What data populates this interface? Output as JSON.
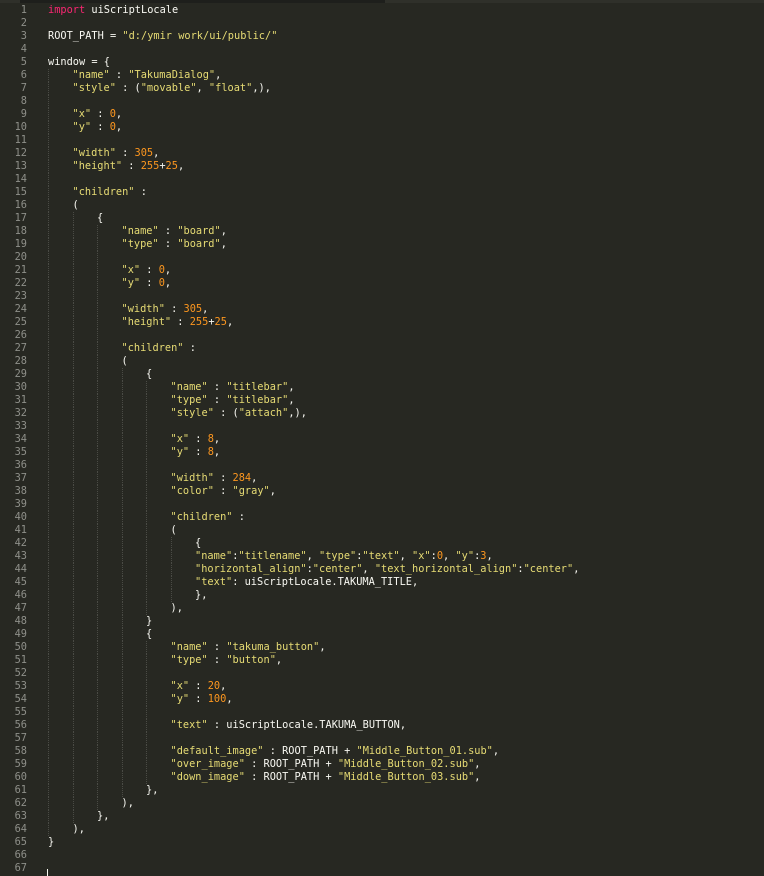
{
  "editor": {
    "language": "python",
    "theme_colors": {
      "background": "#272822",
      "keyword": "#f92672",
      "string": "#e6db74",
      "number": "#fd971f",
      "text": "#f8f8f2",
      "gutter": "#8f908a"
    },
    "lines": [
      {
        "n": "1",
        "indent": 0,
        "tokens": [
          [
            "imp",
            "import"
          ],
          [
            "txt",
            " uiScriptLocale"
          ]
        ]
      },
      {
        "n": "2",
        "indent": 0,
        "tokens": []
      },
      {
        "n": "3",
        "indent": 0,
        "tokens": [
          [
            "txt",
            "ROOT_PATH = "
          ],
          [
            "str",
            "\"d:/ymir work/ui/public/\""
          ]
        ]
      },
      {
        "n": "4",
        "indent": 0,
        "tokens": []
      },
      {
        "n": "5",
        "indent": 0,
        "tokens": [
          [
            "txt",
            "window = {"
          ]
        ]
      },
      {
        "n": "6",
        "indent": 1,
        "tokens": [
          [
            "str",
            "\"name\""
          ],
          [
            "txt",
            " : "
          ],
          [
            "str",
            "\"TakumaDialog\""
          ],
          [
            "txt",
            ","
          ]
        ]
      },
      {
        "n": "7",
        "indent": 1,
        "tokens": [
          [
            "str",
            "\"style\""
          ],
          [
            "txt",
            " : ("
          ],
          [
            "str",
            "\"movable\""
          ],
          [
            "txt",
            ", "
          ],
          [
            "str",
            "\"float\""
          ],
          [
            "txt",
            ",),"
          ]
        ]
      },
      {
        "n": "8",
        "indent": 1,
        "tokens": []
      },
      {
        "n": "9",
        "indent": 1,
        "tokens": [
          [
            "str",
            "\"x\""
          ],
          [
            "txt",
            " : "
          ],
          [
            "num",
            "0"
          ],
          [
            "txt",
            ","
          ]
        ]
      },
      {
        "n": "10",
        "indent": 1,
        "tokens": [
          [
            "str",
            "\"y\""
          ],
          [
            "txt",
            " : "
          ],
          [
            "num",
            "0"
          ],
          [
            "txt",
            ","
          ]
        ]
      },
      {
        "n": "11",
        "indent": 1,
        "tokens": []
      },
      {
        "n": "12",
        "indent": 1,
        "tokens": [
          [
            "str",
            "\"width\""
          ],
          [
            "txt",
            " : "
          ],
          [
            "num",
            "305"
          ],
          [
            "txt",
            ","
          ]
        ]
      },
      {
        "n": "13",
        "indent": 1,
        "tokens": [
          [
            "str",
            "\"height\""
          ],
          [
            "txt",
            " : "
          ],
          [
            "num",
            "255"
          ],
          [
            "txt",
            "+"
          ],
          [
            "num",
            "25"
          ],
          [
            "txt",
            ","
          ]
        ]
      },
      {
        "n": "14",
        "indent": 1,
        "tokens": []
      },
      {
        "n": "15",
        "indent": 1,
        "tokens": [
          [
            "str",
            "\"children\""
          ],
          [
            "txt",
            " :"
          ]
        ]
      },
      {
        "n": "16",
        "indent": 1,
        "tokens": [
          [
            "txt",
            "("
          ]
        ]
      },
      {
        "n": "17",
        "indent": 2,
        "tokens": [
          [
            "txt",
            "{"
          ]
        ]
      },
      {
        "n": "18",
        "indent": 3,
        "tokens": [
          [
            "str",
            "\"name\""
          ],
          [
            "txt",
            " : "
          ],
          [
            "str",
            "\"board\""
          ],
          [
            "txt",
            ","
          ]
        ]
      },
      {
        "n": "19",
        "indent": 3,
        "tokens": [
          [
            "str",
            "\"type\""
          ],
          [
            "txt",
            " : "
          ],
          [
            "str",
            "\"board\""
          ],
          [
            "txt",
            ","
          ]
        ]
      },
      {
        "n": "20",
        "indent": 3,
        "tokens": []
      },
      {
        "n": "21",
        "indent": 3,
        "tokens": [
          [
            "str",
            "\"x\""
          ],
          [
            "txt",
            " : "
          ],
          [
            "num",
            "0"
          ],
          [
            "txt",
            ","
          ]
        ]
      },
      {
        "n": "22",
        "indent": 3,
        "tokens": [
          [
            "str",
            "\"y\""
          ],
          [
            "txt",
            " : "
          ],
          [
            "num",
            "0"
          ],
          [
            "txt",
            ","
          ]
        ]
      },
      {
        "n": "23",
        "indent": 3,
        "tokens": []
      },
      {
        "n": "24",
        "indent": 3,
        "tokens": [
          [
            "str",
            "\"width\""
          ],
          [
            "txt",
            " : "
          ],
          [
            "num",
            "305"
          ],
          [
            "txt",
            ","
          ]
        ]
      },
      {
        "n": "25",
        "indent": 3,
        "tokens": [
          [
            "str",
            "\"height\""
          ],
          [
            "txt",
            " : "
          ],
          [
            "num",
            "255"
          ],
          [
            "txt",
            "+"
          ],
          [
            "num",
            "25"
          ],
          [
            "txt",
            ","
          ]
        ]
      },
      {
        "n": "26",
        "indent": 3,
        "tokens": []
      },
      {
        "n": "27",
        "indent": 3,
        "tokens": [
          [
            "str",
            "\"children\""
          ],
          [
            "txt",
            " :"
          ]
        ]
      },
      {
        "n": "28",
        "indent": 3,
        "tokens": [
          [
            "txt",
            "("
          ]
        ]
      },
      {
        "n": "29",
        "indent": 4,
        "tokens": [
          [
            "txt",
            "{"
          ]
        ]
      },
      {
        "n": "30",
        "indent": 5,
        "tokens": [
          [
            "str",
            "\"name\""
          ],
          [
            "txt",
            " : "
          ],
          [
            "str",
            "\"titlebar\""
          ],
          [
            "txt",
            ","
          ]
        ]
      },
      {
        "n": "31",
        "indent": 5,
        "tokens": [
          [
            "str",
            "\"type\""
          ],
          [
            "txt",
            " : "
          ],
          [
            "str",
            "\"titlebar\""
          ],
          [
            "txt",
            ","
          ]
        ]
      },
      {
        "n": "32",
        "indent": 5,
        "tokens": [
          [
            "str",
            "\"style\""
          ],
          [
            "txt",
            " : ("
          ],
          [
            "str",
            "\"attach\""
          ],
          [
            "txt",
            ",),"
          ]
        ]
      },
      {
        "n": "33",
        "indent": 5,
        "tokens": []
      },
      {
        "n": "34",
        "indent": 5,
        "tokens": [
          [
            "str",
            "\"x\""
          ],
          [
            "txt",
            " : "
          ],
          [
            "num",
            "8"
          ],
          [
            "txt",
            ","
          ]
        ]
      },
      {
        "n": "35",
        "indent": 5,
        "tokens": [
          [
            "str",
            "\"y\""
          ],
          [
            "txt",
            " : "
          ],
          [
            "num",
            "8"
          ],
          [
            "txt",
            ","
          ]
        ]
      },
      {
        "n": "36",
        "indent": 5,
        "tokens": []
      },
      {
        "n": "37",
        "indent": 5,
        "tokens": [
          [
            "str",
            "\"width\""
          ],
          [
            "txt",
            " : "
          ],
          [
            "num",
            "284"
          ],
          [
            "txt",
            ","
          ]
        ]
      },
      {
        "n": "38",
        "indent": 5,
        "tokens": [
          [
            "str",
            "\"color\""
          ],
          [
            "txt",
            " : "
          ],
          [
            "str",
            "\"gray\""
          ],
          [
            "txt",
            ","
          ]
        ]
      },
      {
        "n": "39",
        "indent": 5,
        "tokens": []
      },
      {
        "n": "40",
        "indent": 5,
        "tokens": [
          [
            "str",
            "\"children\""
          ],
          [
            "txt",
            " :"
          ]
        ]
      },
      {
        "n": "41",
        "indent": 5,
        "tokens": [
          [
            "txt",
            "("
          ]
        ]
      },
      {
        "n": "42",
        "indent": 6,
        "tokens": [
          [
            "txt",
            "{"
          ]
        ]
      },
      {
        "n": "43",
        "indent": 6,
        "tokens": [
          [
            "str",
            "\"name\""
          ],
          [
            "txt",
            ":"
          ],
          [
            "str",
            "\"titlename\""
          ],
          [
            "txt",
            ", "
          ],
          [
            "str",
            "\"type\""
          ],
          [
            "txt",
            ":"
          ],
          [
            "str",
            "\"text\""
          ],
          [
            "txt",
            ", "
          ],
          [
            "str",
            "\"x\""
          ],
          [
            "txt",
            ":"
          ],
          [
            "num",
            "0"
          ],
          [
            "txt",
            ", "
          ],
          [
            "str",
            "\"y\""
          ],
          [
            "txt",
            ":"
          ],
          [
            "num",
            "3"
          ],
          [
            "txt",
            ","
          ]
        ]
      },
      {
        "n": "44",
        "indent": 6,
        "tokens": [
          [
            "str",
            "\"horizontal_align\""
          ],
          [
            "txt",
            ":"
          ],
          [
            "str",
            "\"center\""
          ],
          [
            "txt",
            ", "
          ],
          [
            "str",
            "\"text_horizontal_align\""
          ],
          [
            "txt",
            ":"
          ],
          [
            "str",
            "\"center\""
          ],
          [
            "txt",
            ","
          ]
        ]
      },
      {
        "n": "45",
        "indent": 6,
        "tokens": [
          [
            "str",
            "\"text\""
          ],
          [
            "txt",
            ": uiScriptLocale.TAKUMA_TITLE,"
          ]
        ]
      },
      {
        "n": "46",
        "indent": 6,
        "tokens": [
          [
            "txt",
            "},"
          ]
        ]
      },
      {
        "n": "47",
        "indent": 5,
        "tokens": [
          [
            "txt",
            "),"
          ]
        ]
      },
      {
        "n": "48",
        "indent": 4,
        "tokens": [
          [
            "txt",
            "}"
          ]
        ]
      },
      {
        "n": "49",
        "indent": 4,
        "tokens": [
          [
            "txt",
            "{"
          ]
        ]
      },
      {
        "n": "50",
        "indent": 5,
        "tokens": [
          [
            "str",
            "\"name\""
          ],
          [
            "txt",
            " : "
          ],
          [
            "str",
            "\"takuma_button\""
          ],
          [
            "txt",
            ","
          ]
        ]
      },
      {
        "n": "51",
        "indent": 5,
        "tokens": [
          [
            "str",
            "\"type\""
          ],
          [
            "txt",
            " : "
          ],
          [
            "str",
            "\"button\""
          ],
          [
            "txt",
            ","
          ]
        ]
      },
      {
        "n": "52",
        "indent": 5,
        "tokens": []
      },
      {
        "n": "53",
        "indent": 5,
        "tokens": [
          [
            "str",
            "\"x\""
          ],
          [
            "txt",
            " : "
          ],
          [
            "num",
            "20"
          ],
          [
            "txt",
            ","
          ]
        ]
      },
      {
        "n": "54",
        "indent": 5,
        "tokens": [
          [
            "str",
            "\"y\""
          ],
          [
            "txt",
            " : "
          ],
          [
            "num",
            "100"
          ],
          [
            "txt",
            ","
          ]
        ]
      },
      {
        "n": "55",
        "indent": 5,
        "tokens": []
      },
      {
        "n": "56",
        "indent": 5,
        "tokens": [
          [
            "str",
            "\"text\""
          ],
          [
            "txt",
            " : uiScriptLocale.TAKUMA_BUTTON,"
          ]
        ]
      },
      {
        "n": "57",
        "indent": 5,
        "tokens": []
      },
      {
        "n": "58",
        "indent": 5,
        "tokens": [
          [
            "str",
            "\"default_image\""
          ],
          [
            "txt",
            " : ROOT_PATH + "
          ],
          [
            "str",
            "\"Middle_Button_01.sub\""
          ],
          [
            "txt",
            ","
          ]
        ]
      },
      {
        "n": "59",
        "indent": 5,
        "tokens": [
          [
            "str",
            "\"over_image\""
          ],
          [
            "txt",
            " : ROOT_PATH + "
          ],
          [
            "str",
            "\"Middle_Button_02.sub\""
          ],
          [
            "txt",
            ","
          ]
        ]
      },
      {
        "n": "60",
        "indent": 5,
        "tokens": [
          [
            "str",
            "\"down_image\""
          ],
          [
            "txt",
            " : ROOT_PATH + "
          ],
          [
            "str",
            "\"Middle_Button_03.sub\""
          ],
          [
            "txt",
            ","
          ]
        ]
      },
      {
        "n": "61",
        "indent": 4,
        "tokens": [
          [
            "txt",
            "},"
          ]
        ]
      },
      {
        "n": "62",
        "indent": 3,
        "tokens": [
          [
            "txt",
            "),"
          ]
        ]
      },
      {
        "n": "63",
        "indent": 2,
        "tokens": [
          [
            "txt",
            "},"
          ]
        ]
      },
      {
        "n": "64",
        "indent": 1,
        "tokens": [
          [
            "txt",
            "),"
          ]
        ]
      },
      {
        "n": "65",
        "indent": 0,
        "tokens": [
          [
            "txt",
            "}"
          ]
        ]
      },
      {
        "n": "66",
        "indent": 0,
        "tokens": []
      },
      {
        "n": "67",
        "indent": 0,
        "tokens": []
      }
    ]
  }
}
